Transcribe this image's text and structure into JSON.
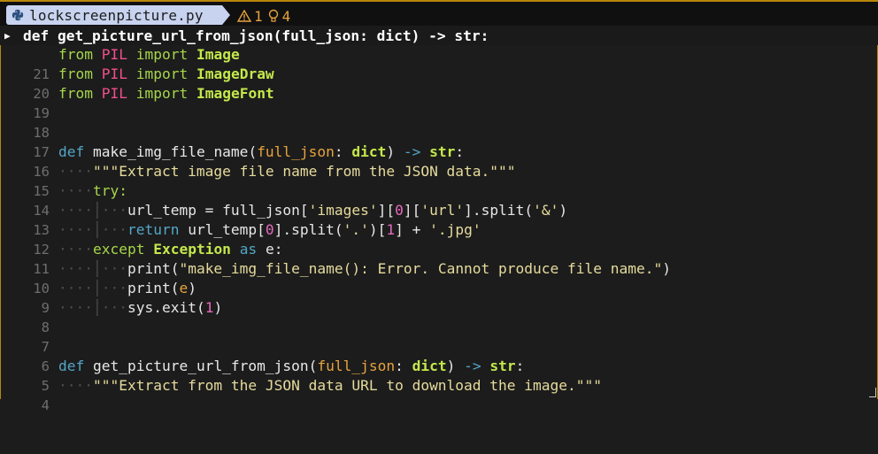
{
  "tab": {
    "filename": "lockscreenpicture.py",
    "icon": "python-icon"
  },
  "diagnostics": {
    "warnings": "1",
    "hints": "4"
  },
  "sticky_context": {
    "def": "def",
    "name": "get_picture_url_from_json",
    "open": "(",
    "param": "full_json",
    "colon": ": ",
    "ptype": "dict",
    "close": ")",
    "arrow": " -> ",
    "rtype": "str",
    "end": ":"
  },
  "lines": [
    {
      "ln": "21",
      "text": "from PIL import Image"
    },
    {
      "ln": "20",
      "text": "from PIL import ImageDraw"
    },
    {
      "ln": "19",
      "text": "from PIL import ImageFont"
    },
    {
      "ln": "18",
      "text": ""
    },
    {
      "ln": "17",
      "text": ""
    },
    {
      "ln": "16",
      "text": "def make_img_file_name(full_json: dict) -> str:"
    },
    {
      "ln": "15",
      "text": "\"\"\"Extract image file name from the JSON data.\"\"\""
    },
    {
      "ln": "14",
      "text": "try:"
    },
    {
      "ln": "13",
      "text": "url_temp = full_json['images'][0]['url'].split('&')"
    },
    {
      "ln": "12",
      "text": "return url_temp[0].split('.')[1] + '.jpg'"
    },
    {
      "ln": "11",
      "text": "except Exception as e:"
    },
    {
      "ln": "10",
      "text": "print(\"make_img_file_name(): Error. Cannot produce file name.\")"
    },
    {
      "ln": "9",
      "text": "print(e)"
    },
    {
      "ln": "8",
      "text": "sys.exit(1)"
    },
    {
      "ln": "7",
      "text": ""
    },
    {
      "ln": "6",
      "text": ""
    },
    {
      "ln": "5",
      "text": "def get_picture_url_from_json(full_json: dict) -> str:"
    },
    {
      "ln": "4",
      "text": "\"\"\"Extract from the JSON data URL to download the image.\"\"\""
    }
  ],
  "tokens": {
    "from": "from",
    "import": "import",
    "PIL": "PIL",
    "Image": "Image",
    "ImageDraw": "ImageDraw",
    "ImageFont": "ImageFont",
    "def": "def",
    "make_img_file_name": "make_img_file_name",
    "full_json": "full_json",
    "dict": "dict",
    "str": "str",
    "arrow": "->",
    "doc1": "\"\"\"Extract image file name from the JSON data.\"\"\"",
    "try": "try",
    "url_temp": "url_temp",
    "split": "split",
    "images": "'images'",
    "url": "'url'",
    "amp": "'&'",
    "zero": "0",
    "one": "1",
    "return": "return",
    "dot": "'.'",
    "jpg": "'.jpg'",
    "except": "except",
    "Exception": "Exception",
    "as": "as",
    "e": "e",
    "print": "print",
    "errmsg": "\"make_img_file_name(): Error. Cannot produce file name.\"",
    "sys": "sys",
    "exit": "exit",
    "get_picture_url_from_json": "get_picture_url_from_json",
    "doc2": "\"\"\"Extract from the JSON data URL to download the image.\"\"\""
  },
  "colors": {
    "keyword": "#53a6c6",
    "class": "#c4e84b",
    "module": "#f04f8c",
    "param": "#e7a33e",
    "string": "#e6db9c",
    "number": "#e66ac0",
    "tab_bg": "#c7d3ef",
    "warning": "#e7a33e"
  }
}
